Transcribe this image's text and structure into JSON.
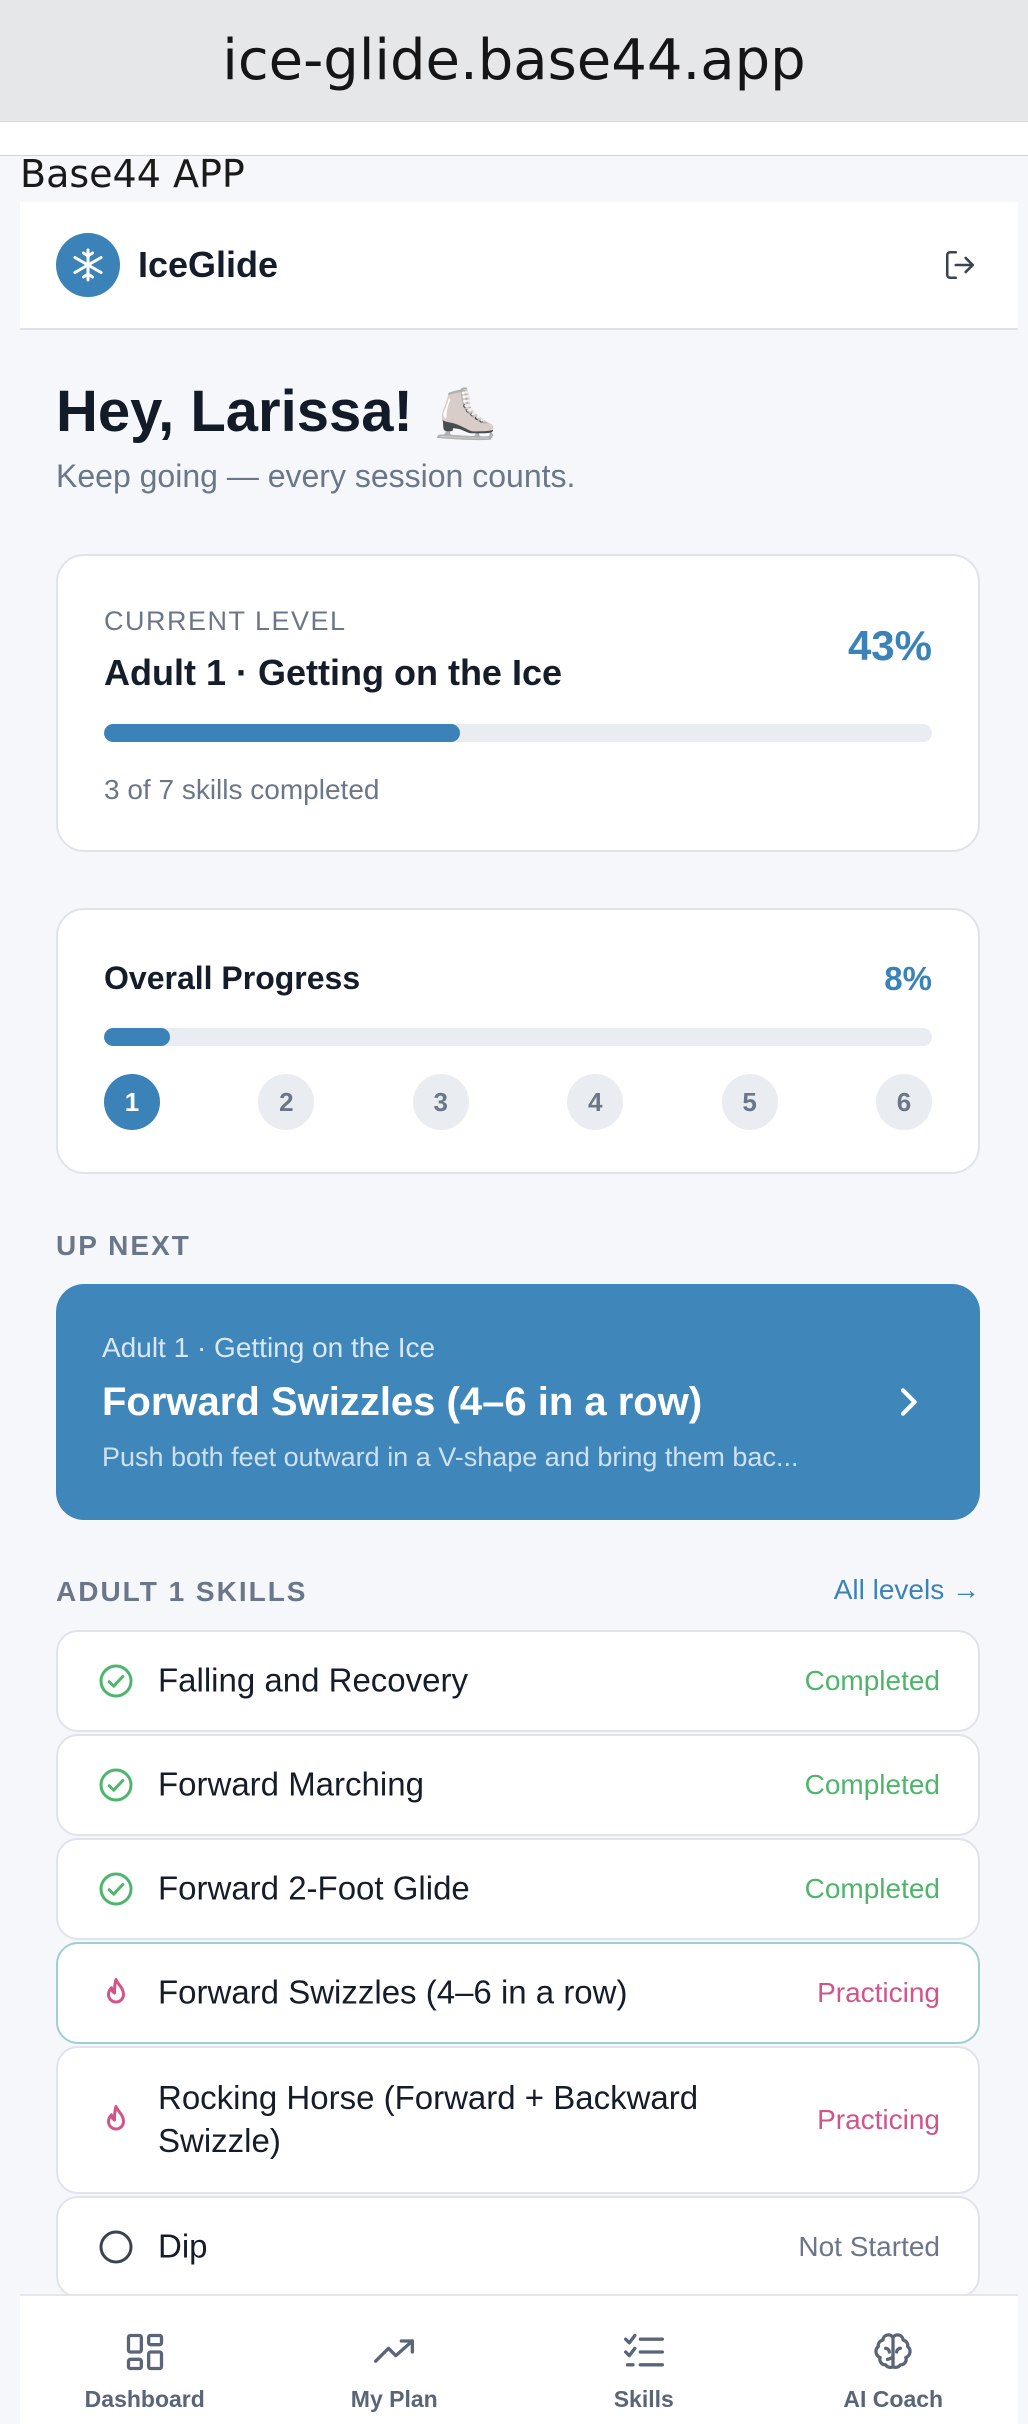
{
  "browser": {
    "url": "ice-glide.base44.app"
  },
  "app_label": "Base44 APP",
  "header": {
    "brand": "IceGlide",
    "logo_icon": "snowflake-icon",
    "logout_icon": "logout-icon"
  },
  "greeting": {
    "title": "Hey, Larissa!",
    "emoji": "⛸️",
    "subtitle": "Keep going — every session counts."
  },
  "current_level": {
    "label": "CURRENT LEVEL",
    "name": "Adult 1 · Getting on the Ice",
    "percent_text": "43%",
    "progress": 0.43,
    "footer": "3 of 7 skills completed"
  },
  "overall": {
    "title": "Overall Progress",
    "percent_text": "8%",
    "progress": 0.08,
    "steps": [
      "1",
      "2",
      "3",
      "4",
      "5",
      "6"
    ],
    "active_step": 0
  },
  "up_next": {
    "label": "UP NEXT",
    "level": "Adult 1 · Getting on the Ice",
    "skill": "Forward Swizzles (4–6 in a row)",
    "description": "Push both feet outward in a V-shape and bring them bac..."
  },
  "skills_section": {
    "label": "ADULT 1 SKILLS",
    "all_levels": "All levels →",
    "items": [
      {
        "name": "Falling and Recovery",
        "status": "Completed",
        "icon": "check-circle-icon"
      },
      {
        "name": "Forward Marching",
        "status": "Completed",
        "icon": "check-circle-icon"
      },
      {
        "name": "Forward 2-Foot Glide",
        "status": "Completed",
        "icon": "check-circle-icon"
      },
      {
        "name": "Forward Swizzles (4–6 in a row)",
        "status": "Practicing",
        "icon": "flame-icon"
      },
      {
        "name": "Rocking Horse (Forward + Backward Swizzle)",
        "status": "Practicing",
        "icon": "flame-icon"
      },
      {
        "name": "Dip",
        "status": "Not Started",
        "icon": "empty-circle-icon"
      }
    ]
  },
  "bottom_nav": [
    {
      "label": "Dashboard",
      "icon": "grid-icon"
    },
    {
      "label": "My Plan",
      "icon": "trending-up-icon"
    },
    {
      "label": "Skills",
      "icon": "checklist-icon"
    },
    {
      "label": "AI Coach",
      "icon": "brain-icon"
    }
  ],
  "colors": {
    "accent": "#3b82b8",
    "completed": "#4fb56b",
    "practicing": "#d1548a",
    "muted": "#6b7789"
  }
}
